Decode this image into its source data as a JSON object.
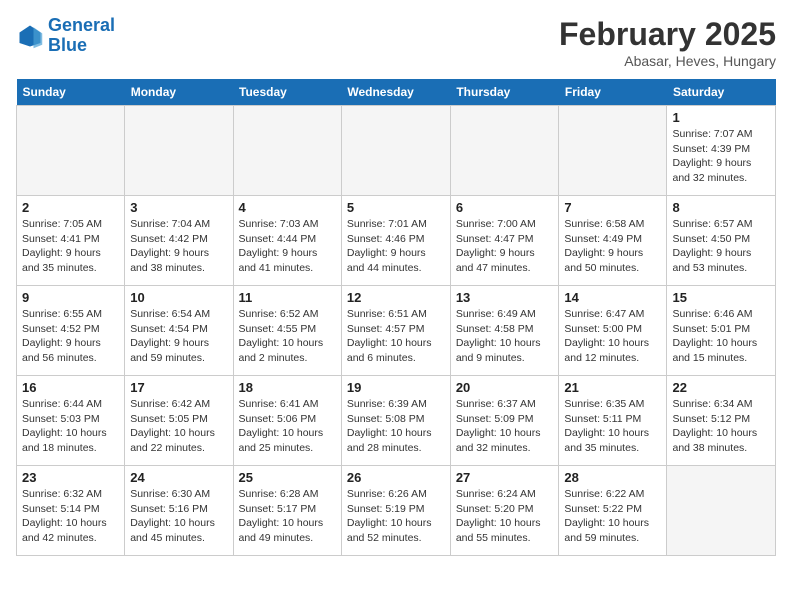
{
  "header": {
    "logo_line1": "General",
    "logo_line2": "Blue",
    "month_year": "February 2025",
    "location": "Abasar, Heves, Hungary"
  },
  "days_of_week": [
    "Sunday",
    "Monday",
    "Tuesday",
    "Wednesday",
    "Thursday",
    "Friday",
    "Saturday"
  ],
  "weeks": [
    [
      {
        "num": "",
        "info": ""
      },
      {
        "num": "",
        "info": ""
      },
      {
        "num": "",
        "info": ""
      },
      {
        "num": "",
        "info": ""
      },
      {
        "num": "",
        "info": ""
      },
      {
        "num": "",
        "info": ""
      },
      {
        "num": "1",
        "info": "Sunrise: 7:07 AM\nSunset: 4:39 PM\nDaylight: 9 hours and 32 minutes."
      }
    ],
    [
      {
        "num": "2",
        "info": "Sunrise: 7:05 AM\nSunset: 4:41 PM\nDaylight: 9 hours and 35 minutes."
      },
      {
        "num": "3",
        "info": "Sunrise: 7:04 AM\nSunset: 4:42 PM\nDaylight: 9 hours and 38 minutes."
      },
      {
        "num": "4",
        "info": "Sunrise: 7:03 AM\nSunset: 4:44 PM\nDaylight: 9 hours and 41 minutes."
      },
      {
        "num": "5",
        "info": "Sunrise: 7:01 AM\nSunset: 4:46 PM\nDaylight: 9 hours and 44 minutes."
      },
      {
        "num": "6",
        "info": "Sunrise: 7:00 AM\nSunset: 4:47 PM\nDaylight: 9 hours and 47 minutes."
      },
      {
        "num": "7",
        "info": "Sunrise: 6:58 AM\nSunset: 4:49 PM\nDaylight: 9 hours and 50 minutes."
      },
      {
        "num": "8",
        "info": "Sunrise: 6:57 AM\nSunset: 4:50 PM\nDaylight: 9 hours and 53 minutes."
      }
    ],
    [
      {
        "num": "9",
        "info": "Sunrise: 6:55 AM\nSunset: 4:52 PM\nDaylight: 9 hours and 56 minutes."
      },
      {
        "num": "10",
        "info": "Sunrise: 6:54 AM\nSunset: 4:54 PM\nDaylight: 9 hours and 59 minutes."
      },
      {
        "num": "11",
        "info": "Sunrise: 6:52 AM\nSunset: 4:55 PM\nDaylight: 10 hours and 2 minutes."
      },
      {
        "num": "12",
        "info": "Sunrise: 6:51 AM\nSunset: 4:57 PM\nDaylight: 10 hours and 6 minutes."
      },
      {
        "num": "13",
        "info": "Sunrise: 6:49 AM\nSunset: 4:58 PM\nDaylight: 10 hours and 9 minutes."
      },
      {
        "num": "14",
        "info": "Sunrise: 6:47 AM\nSunset: 5:00 PM\nDaylight: 10 hours and 12 minutes."
      },
      {
        "num": "15",
        "info": "Sunrise: 6:46 AM\nSunset: 5:01 PM\nDaylight: 10 hours and 15 minutes."
      }
    ],
    [
      {
        "num": "16",
        "info": "Sunrise: 6:44 AM\nSunset: 5:03 PM\nDaylight: 10 hours and 18 minutes."
      },
      {
        "num": "17",
        "info": "Sunrise: 6:42 AM\nSunset: 5:05 PM\nDaylight: 10 hours and 22 minutes."
      },
      {
        "num": "18",
        "info": "Sunrise: 6:41 AM\nSunset: 5:06 PM\nDaylight: 10 hours and 25 minutes."
      },
      {
        "num": "19",
        "info": "Sunrise: 6:39 AM\nSunset: 5:08 PM\nDaylight: 10 hours and 28 minutes."
      },
      {
        "num": "20",
        "info": "Sunrise: 6:37 AM\nSunset: 5:09 PM\nDaylight: 10 hours and 32 minutes."
      },
      {
        "num": "21",
        "info": "Sunrise: 6:35 AM\nSunset: 5:11 PM\nDaylight: 10 hours and 35 minutes."
      },
      {
        "num": "22",
        "info": "Sunrise: 6:34 AM\nSunset: 5:12 PM\nDaylight: 10 hours and 38 minutes."
      }
    ],
    [
      {
        "num": "23",
        "info": "Sunrise: 6:32 AM\nSunset: 5:14 PM\nDaylight: 10 hours and 42 minutes."
      },
      {
        "num": "24",
        "info": "Sunrise: 6:30 AM\nSunset: 5:16 PM\nDaylight: 10 hours and 45 minutes."
      },
      {
        "num": "25",
        "info": "Sunrise: 6:28 AM\nSunset: 5:17 PM\nDaylight: 10 hours and 49 minutes."
      },
      {
        "num": "26",
        "info": "Sunrise: 6:26 AM\nSunset: 5:19 PM\nDaylight: 10 hours and 52 minutes."
      },
      {
        "num": "27",
        "info": "Sunrise: 6:24 AM\nSunset: 5:20 PM\nDaylight: 10 hours and 55 minutes."
      },
      {
        "num": "28",
        "info": "Sunrise: 6:22 AM\nSunset: 5:22 PM\nDaylight: 10 hours and 59 minutes."
      },
      {
        "num": "",
        "info": ""
      }
    ]
  ]
}
